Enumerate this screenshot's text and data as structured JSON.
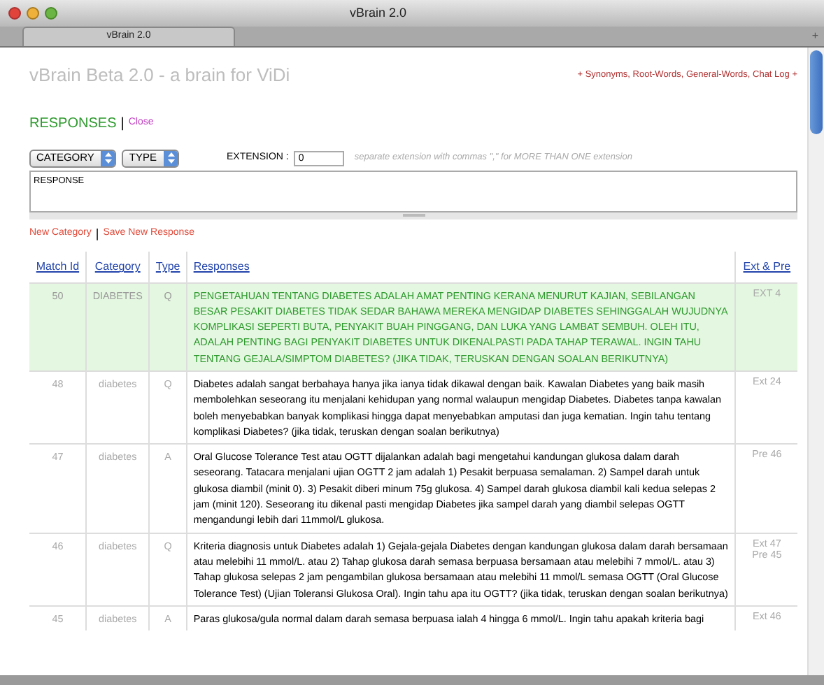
{
  "window": {
    "title": "vBrain 2.0"
  },
  "tabs": [
    {
      "label": "vBrain 2.0",
      "selected": true
    }
  ],
  "new_tab": "+",
  "page_title": "vBrain Beta 2.0 - a brain for ViDi",
  "top_links": "+ Synonyms, Root-Words, General-Words, Chat Log +",
  "section": {
    "title": "RESPONSES",
    "separator": "|",
    "close": "Close"
  },
  "form": {
    "category": "CATEGORY",
    "type": "TYPE",
    "extension_label": "EXTENSION :",
    "extension_value": "0",
    "extension_hint": "separate extension with commas \",\" for MORE THAN ONE extension",
    "response_placeholder": "RESPONSE"
  },
  "actions": [
    {
      "label": "New Category"
    },
    {
      "label": "Save New Response"
    }
  ],
  "actions_separator": "|",
  "table": {
    "columns": [
      "Match Id",
      "Category",
      "Type",
      "Responses",
      "Ext & Pre"
    ],
    "rows": [
      {
        "id": "50",
        "category": "DIABETES",
        "type": "Q",
        "selected": true,
        "response": "PENGETAHUAN TENTANG DIABETES ADALAH AMAT PENTING KERANA MENURUT KAJIAN, SEBILANGAN BESAR PESAKIT DIABETES TIDAK SEDAR BAHAWA MEREKA MENGIDAP DIABETES SEHINGGALAH WUJUDNYA KOMPLIKASI SEPERTI BUTA, PENYAKIT BUAH PINGGANG, DAN LUKA YANG LAMBAT SEMBUH. OLEH ITU, ADALAH PENTING BAGI PENYAKIT DIABETES UNTUK DIKENALPASTI PADA TAHAP TERAWAL. INGIN TAHU TENTANG GEJALA/SIMPTOM DIABETES? (JIKA TIDAK, TERUSKAN DENGAN SOALAN BERIKUTNYA)",
        "links": [
          "EXT 4"
        ]
      },
      {
        "id": "48",
        "category": "diabetes",
        "type": "Q",
        "selected": false,
        "response": "Diabetes adalah sangat berbahaya hanya jika ianya tidak dikawal dengan baik. Kawalan Diabetes yang baik masih membolehkan seseorang itu menjalani kehidupan yang normal walaupun mengidap Diabetes. Diabetes tanpa kawalan boleh menyebabkan banyak komplikasi hingga dapat menyebabkan amputasi dan juga kematian. Ingin tahu tentang komplikasi Diabetes? (jika tidak, teruskan dengan soalan berikutnya)",
        "links": [
          "Ext 24"
        ]
      },
      {
        "id": "47",
        "category": "diabetes",
        "type": "A",
        "selected": false,
        "response": "Oral Glucose Tolerance Test atau OGTT dijalankan adalah bagi mengetahui kandungan glukosa dalam darah seseorang. Tatacara menjalani ujian OGTT 2 jam adalah 1) Pesakit berpuasa semalaman. 2) Sampel darah untuk glukosa diambil (minit 0). 3) Pesakit diberi minum 75g glukosa. 4) Sampel darah glukosa diambil kali kedua selepas 2 jam (minit 120). Seseorang itu dikenal pasti mengidap Diabetes jika sampel darah yang diambil selepas OGTT mengandungi lebih dari 11mmol/L glukosa.",
        "links": [
          "Pre 46"
        ]
      },
      {
        "id": "46",
        "category": "diabetes",
        "type": "Q",
        "selected": false,
        "response": "Kriteria diagnosis untuk Diabetes adalah 1) Gejala-gejala Diabetes dengan kandungan glukosa dalam darah bersamaan atau melebihi 11 mmol/L. atau 2) Tahap glukosa darah semasa berpuasa bersamaan atau melebihi 7 mmol/L. atau 3) Tahap glukosa selepas 2 jam pengambilan glukosa bersamaan atau melebihi 11 mmol/L semasa OGTT (Oral Glucose Tolerance Test) (Ujian Toleransi Glukosa Oral). Ingin tahu apa itu OGTT? (jika tidak, teruskan dengan soalan berikutnya)",
        "links": [
          "Ext 47",
          "Pre 45"
        ]
      },
      {
        "id": "45",
        "category": "diabetes",
        "type": "A",
        "selected": false,
        "response": "Paras glukosa/gula normal dalam darah semasa berpuasa ialah 4 hingga 6 mmol/L. Ingin tahu apakah kriteria bagi",
        "links": [
          "Ext 46"
        ]
      }
    ]
  }
}
